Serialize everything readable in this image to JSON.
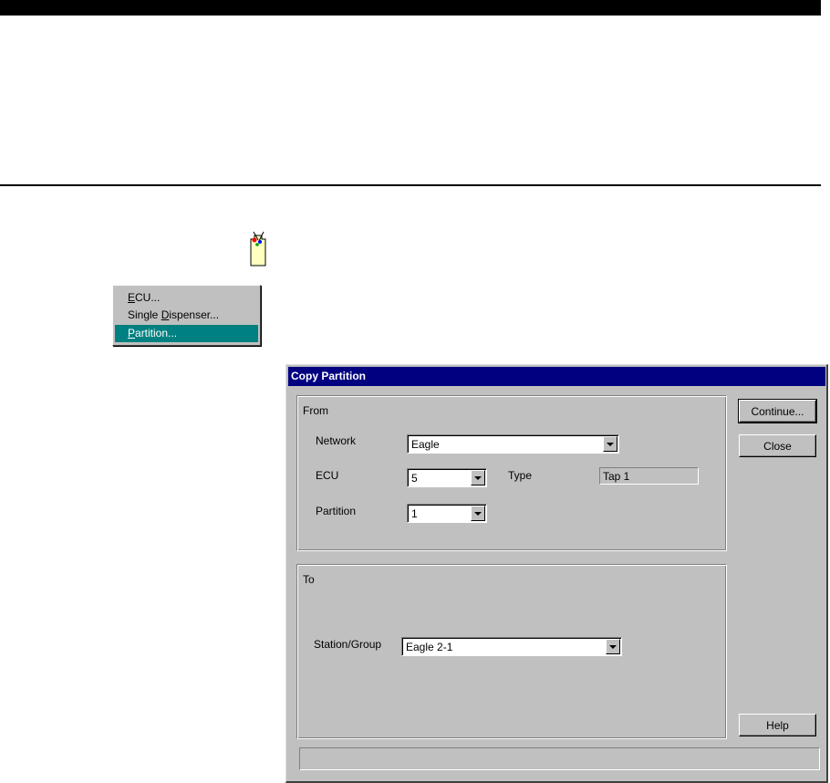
{
  "menu": {
    "items": [
      {
        "mnemonic": "E",
        "rest": "CU...",
        "prefix": ""
      },
      {
        "prefix": "Single ",
        "mnemonic": "D",
        "rest": "ispenser..."
      },
      {
        "prefix": "",
        "mnemonic": "P",
        "rest": "artition..."
      }
    ]
  },
  "icons": {
    "app": "copy-partition-app-icon"
  },
  "dialog": {
    "title": "Copy Partition",
    "from": {
      "label": "From",
      "network_label": "Network",
      "network_value": "Eagle",
      "ecu_label": "ECU",
      "ecu_value": "5",
      "type_label": "Type",
      "type_value": "Tap 1",
      "partition_label": "Partition",
      "partition_value": "1"
    },
    "to": {
      "label": "To",
      "station_label": "Station/Group",
      "station_value": "Eagle 2-1"
    },
    "buttons": {
      "continue": "Continue...",
      "close": "Close",
      "help": "Help"
    },
    "status": ""
  },
  "colors": {
    "title_bar": "#000080",
    "menu_highlight": "#008080",
    "face": "#c0c0c0"
  }
}
